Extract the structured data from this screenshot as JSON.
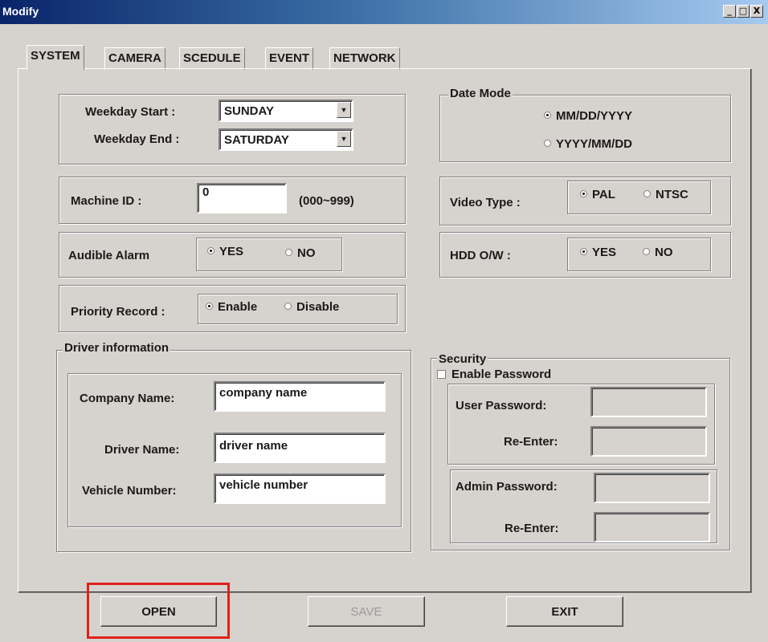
{
  "window": {
    "title": "Modify",
    "minimize": "_",
    "maximize": "□",
    "close": "X"
  },
  "tabs": [
    "SYSTEM",
    "CAMERA",
    "SCEDULE",
    "EVENT",
    "NETWORK"
  ],
  "weekday": {
    "start_label": "Weekday Start :",
    "start_value": "SUNDAY",
    "end_label": "Weekday End :",
    "end_value": "SATURDAY"
  },
  "date_mode": {
    "legend": "Date Mode",
    "option1": "MM/DD/YYYY",
    "option2": "YYYY/MM/DD",
    "selected": "MM/DD/YYYY"
  },
  "machine": {
    "label": "Machine ID :",
    "value": "0",
    "range": "(000~999)"
  },
  "video": {
    "label": "Video Type :",
    "pal": "PAL",
    "ntsc": "NTSC",
    "selected": "PAL"
  },
  "audible": {
    "label": "Audible Alarm",
    "yes": "YES",
    "no": "NO",
    "selected": "YES"
  },
  "hdd": {
    "label": "HDD O/W :",
    "yes": "YES",
    "no": "NO",
    "selected": "YES"
  },
  "priority": {
    "label": "Priority Record :",
    "enable": "Enable",
    "disable": "Disable",
    "selected": "Enable"
  },
  "driver": {
    "legend": "Driver information",
    "company_label": "Company Name:",
    "company_value": "company name",
    "driver_label": "Driver Name:",
    "driver_value": "driver name",
    "vehicle_label": "Vehicle Number:",
    "vehicle_value": "vehicle number"
  },
  "security": {
    "legend": "Security",
    "enable_password": "Enable Password",
    "enable_checked": false,
    "user_password_label": "User Password:",
    "reenter_label": "Re-Enter:",
    "admin_password_label": "Admin Password:",
    "reenter2_label": "Re-Enter:"
  },
  "buttons": {
    "open": "OPEN",
    "save": "SAVE",
    "exit": "EXIT"
  },
  "colors": {
    "titlebar_start": "#0a246a",
    "titlebar_end": "#a6caf0",
    "face": "#d6d3ce",
    "highlight": "#e0201c"
  }
}
